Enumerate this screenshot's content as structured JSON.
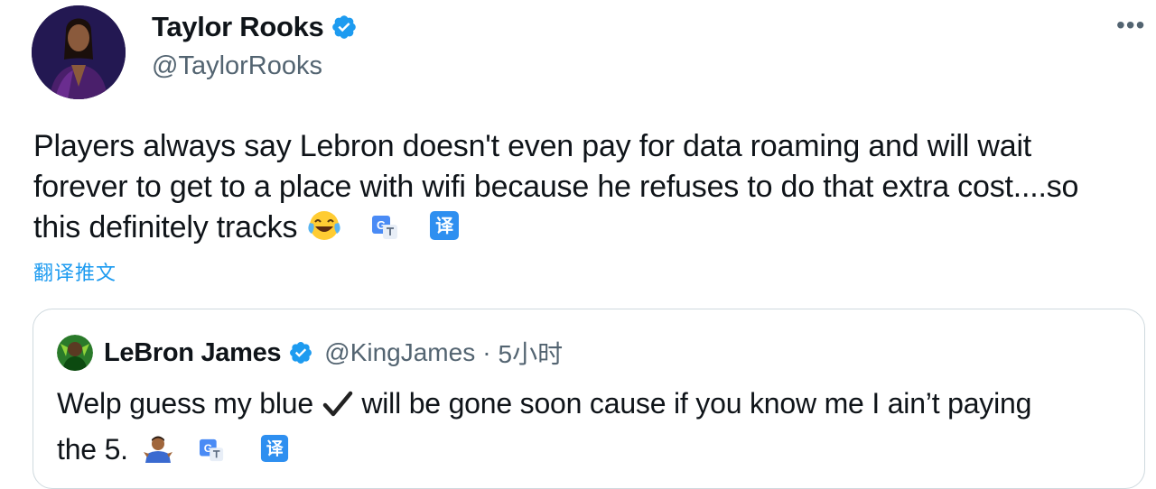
{
  "tweet": {
    "author": {
      "display_name": "Taylor Rooks",
      "handle": "@TaylorRooks",
      "verified": true,
      "avatar_icon": "profile-photo"
    },
    "more_label": "•••",
    "text": "Players always say Lebron doesn't even pay for data roaming and will wait forever to get to a place with wifi because he refuses to do that extra cost....so this definitely tracks",
    "emoji": "face-with-tears-of-joy",
    "translate_link": "翻译推文"
  },
  "quoted_tweet": {
    "author": {
      "display_name": "LeBron James",
      "handle": "@KingJames",
      "separator": "·",
      "time": "5小时",
      "verified": true
    },
    "text_before": "Welp guess my blue",
    "text_after": "will be gone soon cause if you know me I ain’t paying",
    "text_end": "the 5.",
    "emoji": "man-shrugging"
  },
  "colors": {
    "verified_blue": "#1d9bf0",
    "secondary_text": "#536471",
    "border": "#cfd9de"
  }
}
